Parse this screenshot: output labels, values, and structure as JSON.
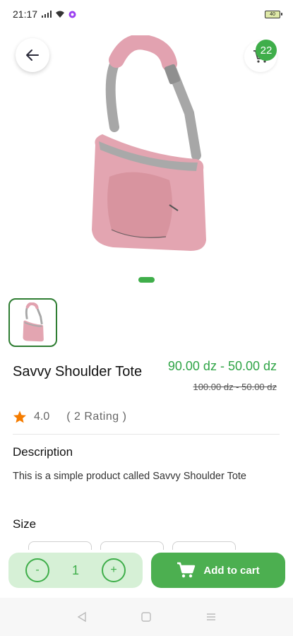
{
  "status_bar": {
    "time": "21:17",
    "battery": "40"
  },
  "header": {
    "cart_count": "22"
  },
  "product": {
    "title": "Savvy Shoulder Tote",
    "price_current": "90.00 dz - 50.00 dz",
    "price_old": "100.00 dz - 50.00 dz",
    "rating_value": "4.0",
    "rating_count": "( 2  Rating )"
  },
  "description": {
    "heading": "Description",
    "text": "This is a simple product called Savvy Shoulder Tote"
  },
  "size": {
    "heading": "Size"
  },
  "bottom_bar": {
    "quantity": "1",
    "minus": "-",
    "plus": "+",
    "add_to_cart_label": "Add to cart"
  },
  "colors": {
    "accent": "#4caf50",
    "bag": "#e0a3ae",
    "strap": "#9b9b9b"
  },
  "icons": [
    "back-arrow-icon",
    "cart-icon",
    "star-icon",
    "nav-back-icon",
    "nav-home-icon",
    "nav-menu-icon"
  ]
}
